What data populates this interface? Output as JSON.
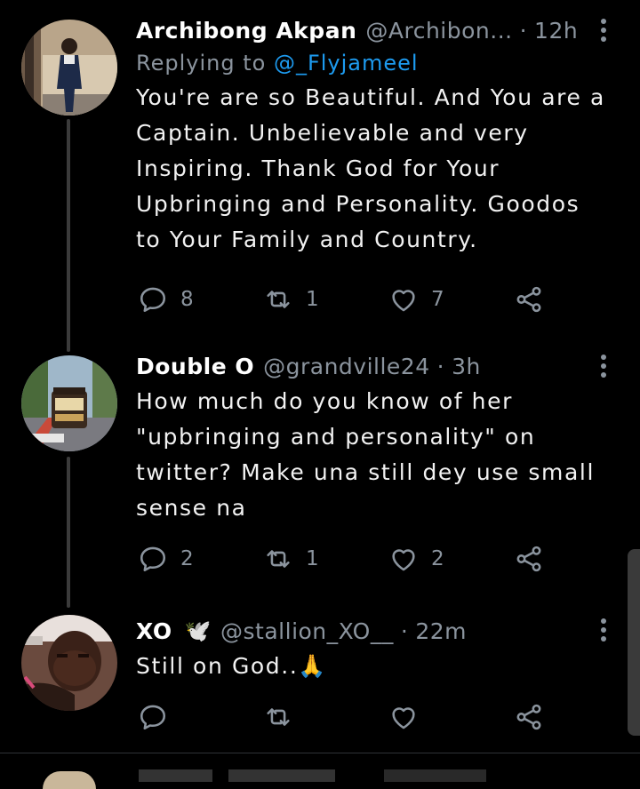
{
  "colors": {
    "background": "#000000",
    "text": "#e7e9ea",
    "muted": "#8b949e",
    "mention": "#1d9bf0",
    "thread_line": "#3b3b3b"
  },
  "replies": [
    {
      "name": "Archibong Akpan",
      "handle": "@Archibon...",
      "separator": "·",
      "time": "12h",
      "replying_prefix": "Replying to ",
      "replying_to": "@_Flyjameel",
      "text": "You're are so Beautiful. And You are a Captain. Unbelievable and very Inspiring. Thank God for Your Upbringing and Personality. Goodos to Your Family and Country.",
      "replies": "8",
      "retweets": "1",
      "likes": "7",
      "avatar": "man-in-suit-photo"
    },
    {
      "name": "Double O",
      "handle": "@grandville24",
      "separator": "·",
      "time": "3h",
      "text": "How much do you know of her \"upbringing and personality\" on twitter? Make una still dey use small sense na",
      "replies": "2",
      "retweets": "1",
      "likes": "2",
      "avatar": "cable-car-photo"
    },
    {
      "name": "XO",
      "name_emoji": "🕊️",
      "handle": "@stallion_XO__",
      "separator": "·",
      "time": "22m",
      "text": "Still on God..🙏",
      "replies": "",
      "retweets": "",
      "likes": "",
      "avatar": "selfie-photo"
    }
  ],
  "icons": {
    "reply": "reply-icon",
    "retweet": "retweet-icon",
    "like": "heart-icon",
    "share": "share-icon",
    "more": "more-vertical-icon"
  }
}
